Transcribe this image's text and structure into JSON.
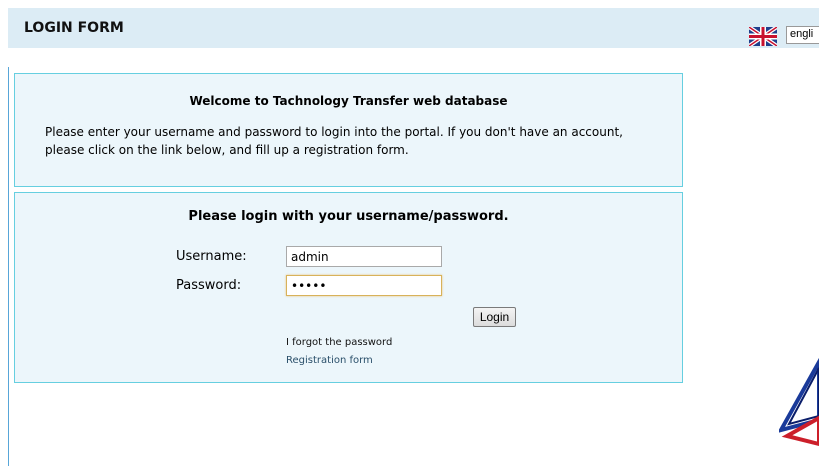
{
  "header": {
    "title": "LOGIN FORM",
    "language": {
      "selected": "engli",
      "flag_icon": "uk-flag-icon"
    }
  },
  "welcome": {
    "title": "Welcome to Tachnology Transfer web database",
    "text": "Please enter your username and password to login into the portal. If you don't have an account, please click on the link below, and fill up a registration form."
  },
  "login": {
    "title": "Please login with your username/password.",
    "username_label": "Username:",
    "username_value": "admin",
    "password_label": "Password:",
    "password_value": "admin",
    "button_label": "Login",
    "forgot_link": "I forgot the password",
    "register_link": "Registration form"
  },
  "colors": {
    "header_bg": "#dcecf5",
    "panel_bg": "#ecf6fb",
    "panel_border": "#66cfe0"
  }
}
